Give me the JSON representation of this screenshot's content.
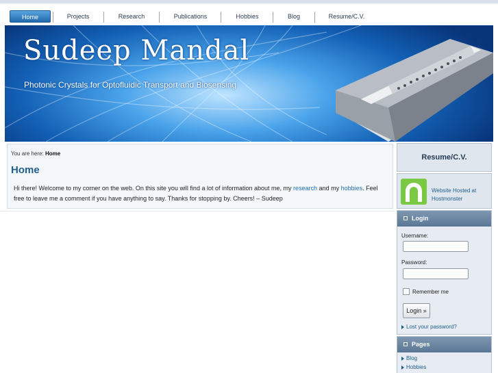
{
  "nav": {
    "items": [
      {
        "label": "Home",
        "active": true
      },
      {
        "label": "Projects",
        "active": false
      },
      {
        "label": "Research",
        "active": false
      },
      {
        "label": "Publications",
        "active": false
      },
      {
        "label": "Hobbies",
        "active": false
      },
      {
        "label": "Blog",
        "active": false
      },
      {
        "label": "Resume/C.V.",
        "active": false
      }
    ]
  },
  "banner": {
    "title": "Sudeep Mandal",
    "subtitle": "Photonic Crystals for Optofluidic Transport and Biosensing"
  },
  "breadcrumb": {
    "prefix": "You are here:",
    "current": "Home"
  },
  "main": {
    "title": "Home",
    "text_1": "Hi there! Welcome to my corner on the web. On this site you will find a lot of information about me, my",
    "link_research": "research",
    "text_2": "and my",
    "link_hobbies": "hobbies",
    "text_3": ". Feel free to leave me a comment if you have anything to say. Thanks for stopping by.  Cheers! – Sudeep"
  },
  "sidebar": {
    "resume_link": "Resume/C.V.",
    "hosted_text": "Website Hosted at Hostmonster",
    "login": {
      "heading": "Login",
      "username_label": "Username:",
      "password_label": "Password:",
      "remember_label": "Remember me",
      "button_label": "Login »",
      "lost_password": "Lost your password?"
    },
    "pages": {
      "heading": "Pages",
      "items": [
        "Blog",
        "Hobbies"
      ]
    }
  },
  "colors": {
    "accent": "#1f5d8c",
    "link": "#1f6fb8",
    "nav_active": "#2169ad"
  }
}
